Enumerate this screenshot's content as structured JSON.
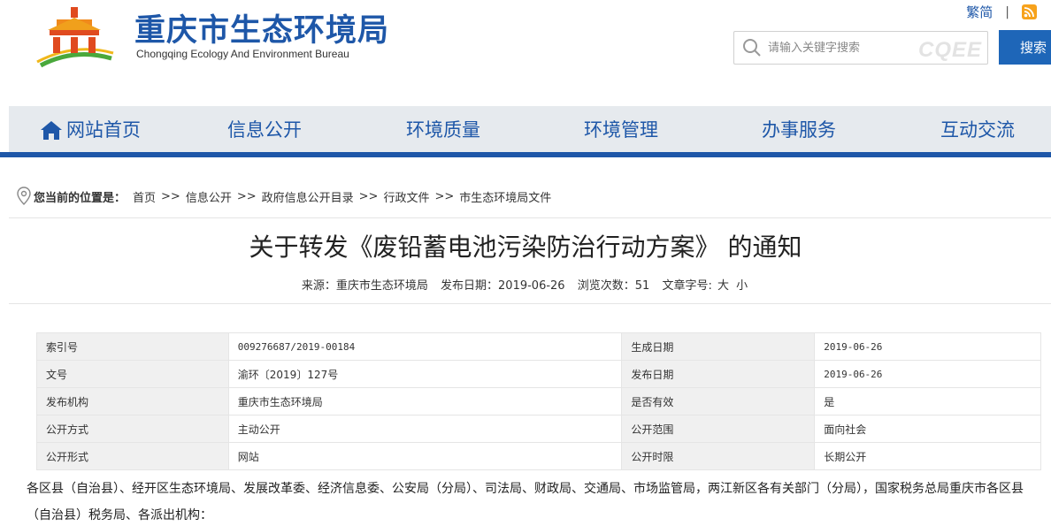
{
  "header": {
    "site_title": "重庆市生态环境局",
    "site_subtitle": "Chongqing Ecology And Environment Bureau",
    "lang_link": "繁简",
    "separator": "|",
    "search_placeholder": "请输入关键字搜索",
    "search_watermark": "CQEE",
    "search_button": "搜索"
  },
  "nav": {
    "items": [
      {
        "label": "网站首页",
        "icon": "home-icon"
      },
      {
        "label": "信息公开"
      },
      {
        "label": "环境质量"
      },
      {
        "label": "环境管理"
      },
      {
        "label": "办事服务"
      },
      {
        "label": "互动交流"
      }
    ]
  },
  "breadcrumb": {
    "label": "您当前的位置是：",
    "separator": ">>",
    "items": [
      "首页",
      "信息公开",
      "政府信息公开目录",
      "行政文件",
      "市生态环境局文件"
    ]
  },
  "article": {
    "title": "关于转发《废铅蓄电池污染防治行动方案》 的通知",
    "meta": {
      "source_label": "来源：",
      "source": "重庆市生态环境局",
      "date_label": "发布日期：",
      "date": "2019-06-26",
      "views_label": "浏览次数：",
      "views": "51",
      "font_label": "文章字号:",
      "font_large": "大",
      "font_small": "小"
    },
    "info": [
      {
        "k1": "索引号",
        "v1": "009276687/2019-00184",
        "k2": "生成日期",
        "v2": "2019-06-26"
      },
      {
        "k1": "文号",
        "v1": "渝环〔2019〕127号",
        "k2": "发布日期",
        "v2": "2019-06-26"
      },
      {
        "k1": "发布机构",
        "v1": "重庆市生态环境局",
        "k2": "是否有效",
        "v2": "是"
      },
      {
        "k1": "公开方式",
        "v1": "主动公开",
        "k2": "公开范围",
        "v2": "面向社会"
      },
      {
        "k1": "公开形式",
        "v1": "网站",
        "k2": "公开时限",
        "v2": "长期公开"
      }
    ],
    "body": "各区县（自治县）、经开区生态环境局、发展改革委、经济信息委、公安局（分局）、司法局、财政局、交通局、市场监管局，两江新区各有关部门（分局），国家税务总局重庆市各区县（自治县）税务局、各派出机构："
  },
  "colors": {
    "brand_blue": "#1e57a8",
    "button_blue": "#1e66b8",
    "nav_bg": "#e6eaee",
    "rss_orange": "#f7a21b"
  }
}
